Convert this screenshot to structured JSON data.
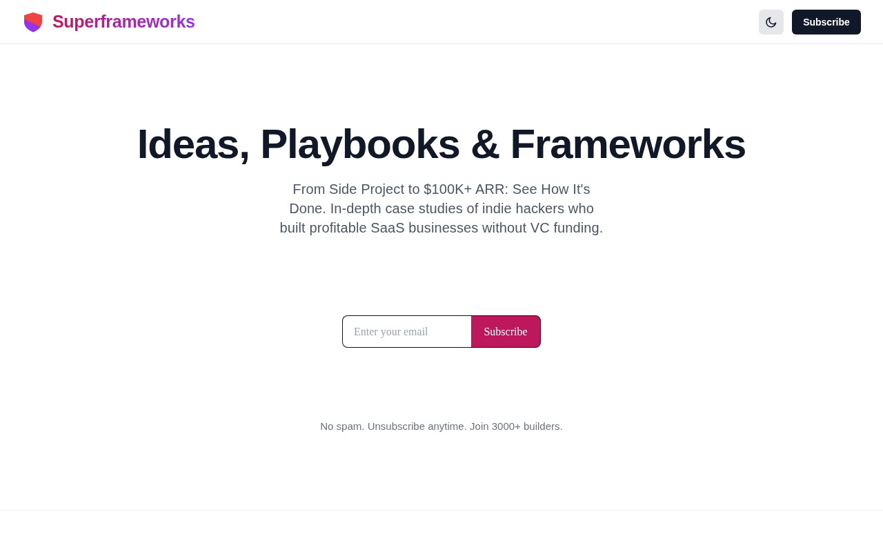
{
  "header": {
    "brand": "Superframeworks",
    "subscribe_button": "Subscribe"
  },
  "hero": {
    "title": "Ideas, Playbooks & Frameworks",
    "subtitle": "From Side Project to $100K+ ARR: See How It's Done. In-depth case studies of indie hackers who built profitable SaaS businesses without VC funding.",
    "signup": {
      "placeholder": "Enter your email",
      "button": "Subscribe"
    },
    "note": "No spam. Unsubscribe anytime. Join 3000+ builders."
  }
}
